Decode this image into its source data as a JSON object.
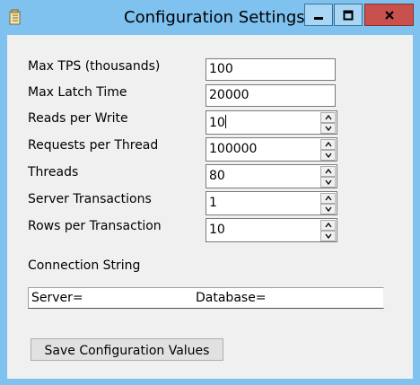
{
  "window": {
    "title": "Configuration Settings",
    "controls": {
      "minimize_icon": "minimize-icon",
      "maximize_icon": "maximize-icon",
      "close_icon": "close-icon"
    }
  },
  "fields": [
    {
      "label": "Max TPS (thousands)",
      "value": "100",
      "type": "text"
    },
    {
      "label": "Max Latch Time",
      "value": "20000",
      "type": "text"
    },
    {
      "label": "Reads per Write",
      "value": "10",
      "type": "spin"
    },
    {
      "label": "Requests per Thread",
      "value": "100000",
      "type": "spin"
    },
    {
      "label": "Threads",
      "value": "80",
      "type": "spin"
    },
    {
      "label": "Server Transactions",
      "value": "1",
      "type": "spin"
    },
    {
      "label": "Rows per Transaction",
      "value": "10",
      "type": "spin"
    }
  ],
  "connection": {
    "label": "Connection String",
    "server_text": "Server=",
    "database_text": "Database="
  },
  "save_button_label": "Save Configuration Values",
  "colors": {
    "titlebar": "#7fc2f0",
    "client": "#f0f0f0",
    "close_button": "#c8504d"
  }
}
